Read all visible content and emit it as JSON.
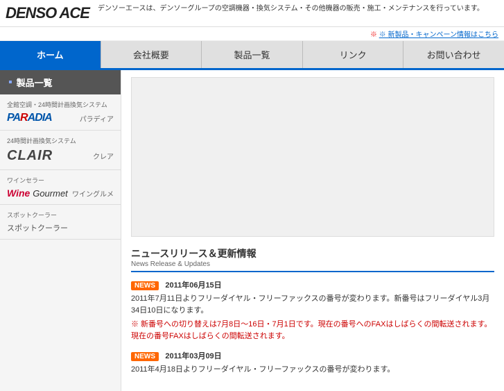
{
  "header": {
    "logo": "DENSO ACE",
    "description": "デンソーエースは、デンソーグループの空調機器・換気システム・その他機器の販売・施工・メンテナンスを行っています。",
    "notice": "※ 新製品・キャンペーン情報はこちら"
  },
  "nav": {
    "items": [
      {
        "label": "ホーム",
        "active": true
      },
      {
        "label": "会社概要",
        "active": false
      },
      {
        "label": "製品一覧",
        "active": false
      },
      {
        "label": "リンク",
        "active": false
      },
      {
        "label": "お問い合わせ",
        "active": false
      }
    ]
  },
  "sidebar": {
    "header": "製品一覧",
    "sections": [
      {
        "title": "全館空調・24時間計画換気システム",
        "product_name": "パラディア",
        "logo_type": "paradia"
      },
      {
        "title": "24時間計画換気システム",
        "product_name": "クレア",
        "logo_type": "clair"
      },
      {
        "title": "ワインセラー",
        "product_name": "ワイングルメ",
        "logo_type": "wine"
      },
      {
        "title": "スポットクーラー",
        "product_name": "",
        "logo_type": "spot"
      }
    ]
  },
  "news": {
    "title_jp": "ニュースリリース＆更新情報",
    "title_en": "News Release & Updates",
    "items": [
      {
        "badge": "NEWS",
        "date": "2011年06月15日",
        "body": "2011年7月11日よりフリーダイヤル・フリーファックスの番号が変わります。新番号はフリーダイヤル3月34日10日になります。",
        "note": "※ 新番号への切り替えは7月8日〜16日・7月1日です。現在の番号へのFAXはしばらくの間転送されます。現在の番号FAXはしばらくの間転送されます。"
      },
      {
        "badge": "NEWS",
        "date": "2011年03月09日",
        "body": "2011年4月18日よりフリーダイヤル・フリーファックスの番号が変わります。",
        "note": ""
      }
    ]
  }
}
